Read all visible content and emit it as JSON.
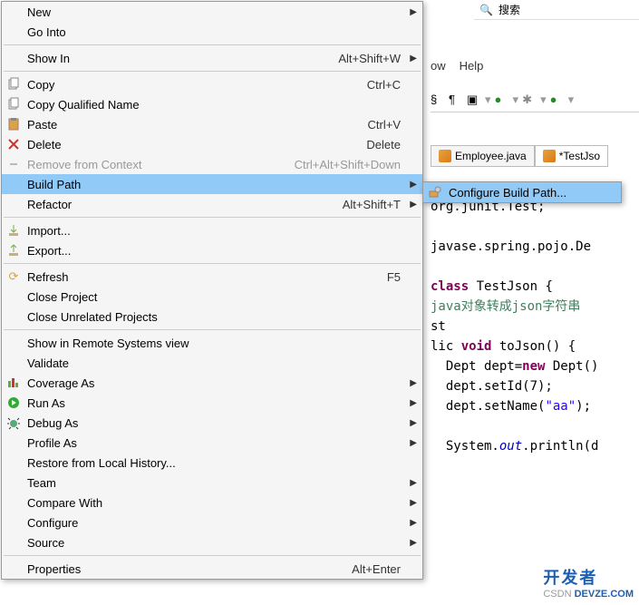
{
  "topbar": {
    "search_text": "搜索"
  },
  "menubar": {
    "items": [
      "ow",
      "Help"
    ]
  },
  "tabs": [
    {
      "icon": "java",
      "label": "Employee.java",
      "active": false
    },
    {
      "icon": "java",
      "label": "*TestJso",
      "active": true
    }
  ],
  "code": {
    "l1": "org.junit.Test;",
    "l2": "javase.spring.pojo.De",
    "l3a": "class",
    "l3b": " TestJson {",
    "l4": "java对象转成json字符串",
    "l5": "st",
    "l6a": "lic ",
    "l6b": "void",
    "l6c": " toJson() {",
    "l7a": "  Dept dept=",
    "l7b": "new",
    "l7c": " Dept()",
    "l8": "  dept.setId(7);",
    "l9a": "  dept.setName(",
    "l9b": "\"aa\"",
    "l9c": ");",
    "l10a": "  System.",
    "l10b": "out",
    "l10c": ".println(d"
  },
  "menu": {
    "new": "New",
    "go_into": "Go Into",
    "show_in": "Show In",
    "show_in_sc": "Alt+Shift+W",
    "copy": "Copy",
    "copy_sc": "Ctrl+C",
    "copy_qn": "Copy Qualified Name",
    "paste": "Paste",
    "paste_sc": "Ctrl+V",
    "delete": "Delete",
    "delete_sc": "Delete",
    "remove_ctx": "Remove from Context",
    "remove_ctx_sc": "Ctrl+Alt+Shift+Down",
    "build_path": "Build Path",
    "refactor": "Refactor",
    "refactor_sc": "Alt+Shift+T",
    "import": "Import...",
    "export": "Export...",
    "refresh": "Refresh",
    "refresh_sc": "F5",
    "close_proj": "Close Project",
    "close_unrel": "Close Unrelated Projects",
    "show_remote": "Show in Remote Systems view",
    "validate": "Validate",
    "coverage": "Coverage As",
    "run_as": "Run As",
    "debug_as": "Debug As",
    "profile_as": "Profile As",
    "restore": "Restore from Local History...",
    "team": "Team",
    "compare": "Compare With",
    "configure": "Configure",
    "source": "Source",
    "properties": "Properties",
    "properties_sc": "Alt+Enter"
  },
  "submenu": {
    "configure_bp": "Configure Build Path..."
  },
  "watermark": {
    "csdn": "CSDN",
    "brand": "开发者",
    "brand2": "DEVZE.COM"
  }
}
